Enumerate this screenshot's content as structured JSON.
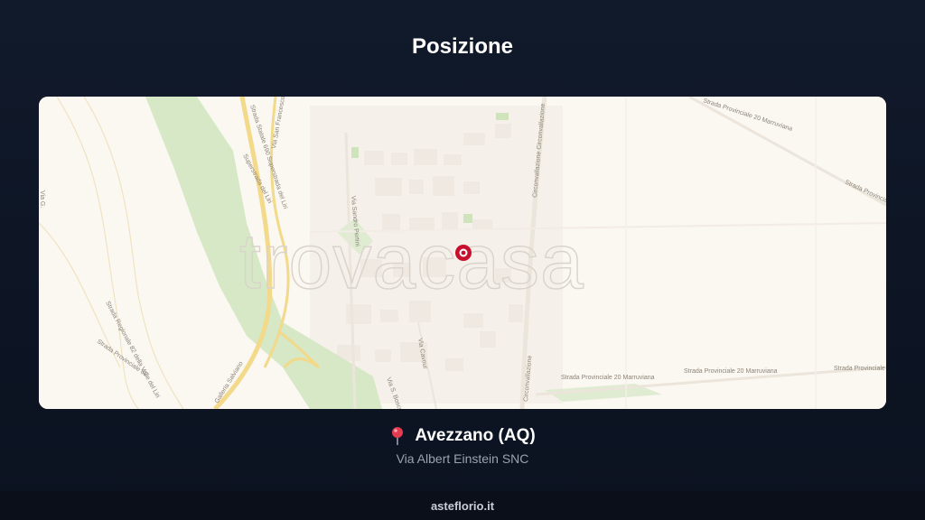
{
  "page": {
    "title": "Posizione"
  },
  "map": {
    "watermark": "trovacasa",
    "road_labels": {
      "via_san_francesco": "Via San Francesco",
      "superstrada_1": "Strada Statale 690 Superstrada del Liri",
      "superstrada_2": "Superstrada del Liri",
      "via_sandro_pertini": "Via Sandro Pertini",
      "circonvallazione_1": "Circonvallazione Circonvallazione",
      "circonvallazione_2": "Circonvallazione",
      "sp20_top": "Strada Provinciale 20 Marruviana",
      "sp_top_right": "Strada Provincial",
      "sp20_bottom_1": "Strada Provinciale 20 Marruviana",
      "sp20_bottom_2": "Strada Provinciale 20 Marruviana",
      "sp_bottom_right": "Strada Provinciale",
      "via_cavour": "Via Cavour",
      "via_g_bosco": "Via S. Bosco",
      "galleria": "Galleria Salviano",
      "sr82": "Strada Regionale 82 della Valle del Liri",
      "sp62": "Strada Provinciale 62",
      "left_edge": "Via G."
    },
    "marker_icon": "map-marker-icon",
    "colors": {
      "marker": "#c8102e",
      "park": "#d6e8c6",
      "road": "#f3d98a"
    }
  },
  "location": {
    "pin_icon": "red-pushpin-icon",
    "city": "Avezzano (AQ)",
    "address": "Via Albert Einstein SNC"
  },
  "footer": {
    "brand": "asteflorio.it"
  }
}
